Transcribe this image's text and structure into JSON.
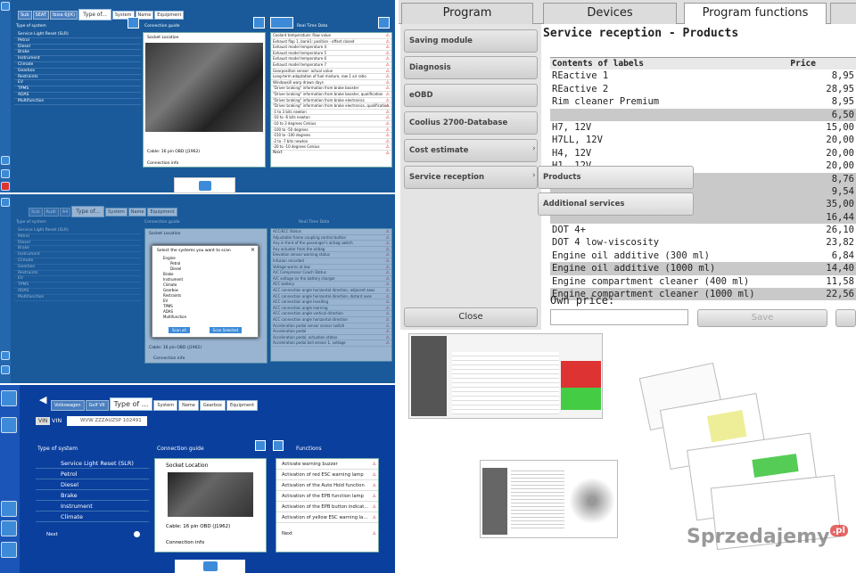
{
  "q1": {
    "tabs": [
      "Sub",
      "SEAT",
      "Ibiza 6J(K)",
      "Type of...",
      "System",
      "Name",
      "Equipment"
    ],
    "left_header": "Type of system",
    "systems": [
      "Service Light Reset (SLR)",
      "Petrol",
      "Diesel",
      "Brake",
      "Instrument",
      "Climate",
      "Gearbox",
      "Restraints",
      "EV",
      "TPMS",
      "ADAS",
      "Multifunction"
    ],
    "mid_header": "Connection guide",
    "socket": "Socket Location",
    "cable": "Cable: 16 pin OBD (J1962)",
    "conn": "Connection info",
    "right_header": "Real Time Data",
    "rtd": [
      "Coolant temperature: Raw value",
      "Exhaust flap 1, bank1: position - offset closed",
      "Exhaust model temperature 4",
      "Exhaust model temperature 5",
      "Exhaust model temperature 6",
      "Exhaust model temperature 7",
      "Gearposition sensor: actual value",
      "Long-term adaptation of fuel mixture, row 1 air ratio",
      "Windowsill warp drawn days",
      "\"Driver braking\" information from brake booster",
      "\"Driver braking\" information from brake booster, qualification",
      "\"Driver braking\" information from brake electronics",
      "\"Driver braking\" information from brake electronics, qualification",
      "-1 to 3 bits newton",
      "-10 to -6 bits newton",
      "-10 to 3 degrees Celsius",
      "-100 to -50 degrees",
      "-150 to -100 degrees",
      "-2 to -7 bits newton",
      "-20 to -10 degrees Celsius"
    ],
    "next": "Next"
  },
  "q2": {
    "tabs": [
      "Sub",
      "Audi",
      "A4",
      "Type of...",
      "System",
      "Name",
      "Equipment"
    ],
    "dialog_title": "Select the systems you want to scan",
    "dialog_items": [
      "Engine",
      "Petrol",
      "Diesel",
      "Brake",
      "Instrument",
      "Climate",
      "Gearbox",
      "Restraints",
      "EV",
      "TPMS",
      "ADAS",
      "Multifunction"
    ],
    "btn_ok": "Scan all",
    "btn_cancel": "Scan Selected",
    "rtd": [
      "ACC/ECC Status",
      "Adjustable frame coupling control button",
      "Any in front of the passenger's airbag switch",
      "Any actuator from the airbag",
      "Elevation sensor warning status",
      "Infusion recorded",
      "Voltage warns at low",
      "A/C Compressor Coach Status",
      "A/C voltage on the battery charger",
      "ACC battery",
      "ACC connection angle horizontal direction, adjacent axes",
      "ACC connection angle horizontal direction, distant axes",
      "ACC connection angle levelling",
      "ACC connection angle learning",
      "ACC connection angle vertical direction",
      "ACC connection angle horizontal direction",
      "Acceleration pedal sensor sensor switch",
      "Acceleration pedal",
      "Acceleration pedal, actuation status",
      "Acceleration pedal bell sensor 1, voltage"
    ]
  },
  "q3": {
    "tabs": [
      "Volkswagen",
      "Golf VII",
      "Type of ...",
      "System",
      "Name",
      "Gearbox",
      "Equipment"
    ],
    "vin_label": "VIN",
    "vin_value": "WVW ZZZAUZSP 102491",
    "left_header": "Type of system",
    "systems": [
      "Service Light Reset (SLR)",
      "Petrol",
      "Diesel",
      "Brake",
      "Instrument",
      "Climate"
    ],
    "next": "Next",
    "mid_header": "Connection guide",
    "socket": "Socket Location",
    "cable": "Cable: 16 pin OBD (J1962)",
    "conn": "Connection info",
    "right_header": "Functions",
    "functions": [
      "Activate warning buzzer",
      "Activation of red ESC warning lamp",
      "Activation of the Auto Hold function",
      "Activation of the EPB function lamp",
      "Activation of the EPB button indicat...",
      "Activation of yellow ESC warning la..."
    ],
    "fnext": "Next"
  },
  "q4": {
    "tabs": [
      "Program",
      "Devices",
      "Program functions",
      ""
    ],
    "menu": [
      "Saving module",
      "Diagnosis",
      "eOBD",
      "Coolius 2700-Database",
      "Cost estimate",
      "Service reception"
    ],
    "submenu": [
      "Products",
      "Additional services"
    ],
    "title": "Service reception - Products",
    "col1": "Contents of labels",
    "col2": "Price",
    "rows": [
      [
        "REactive 1",
        "8,95"
      ],
      [
        "REactive 2",
        "28,95"
      ],
      [
        "Rim cleaner Premium",
        "8,95"
      ],
      [
        "",
        "6,50"
      ],
      [
        "H7, 12V",
        "15,00"
      ],
      [
        "H7LL, 12V",
        "20,00"
      ],
      [
        "H4, 12V",
        "20,00"
      ],
      [
        "H1, 12V",
        "20,00"
      ],
      [
        "",
        "8,76"
      ],
      [
        "",
        "9,54"
      ],
      [
        "",
        "35,00"
      ],
      [
        "",
        "16,44"
      ],
      [
        "DOT 4+",
        "26,10"
      ],
      [
        "DOT 4 low-viscosity",
        "23,82"
      ],
      [
        "Engine oil additive (300 ml)",
        "6,84"
      ],
      [
        "Engine oil additive (1000 ml)",
        "14,40"
      ],
      [
        "Engine compartment cleaner (400 ml)",
        "11,58"
      ],
      [
        "Engine compartment cleaner (1000 ml)",
        "22,56"
      ]
    ],
    "own_price": "Own price:",
    "save": "Save",
    "close": "Close"
  },
  "watermark": "Sprzedajemy",
  "watermark_tld": ".pl"
}
